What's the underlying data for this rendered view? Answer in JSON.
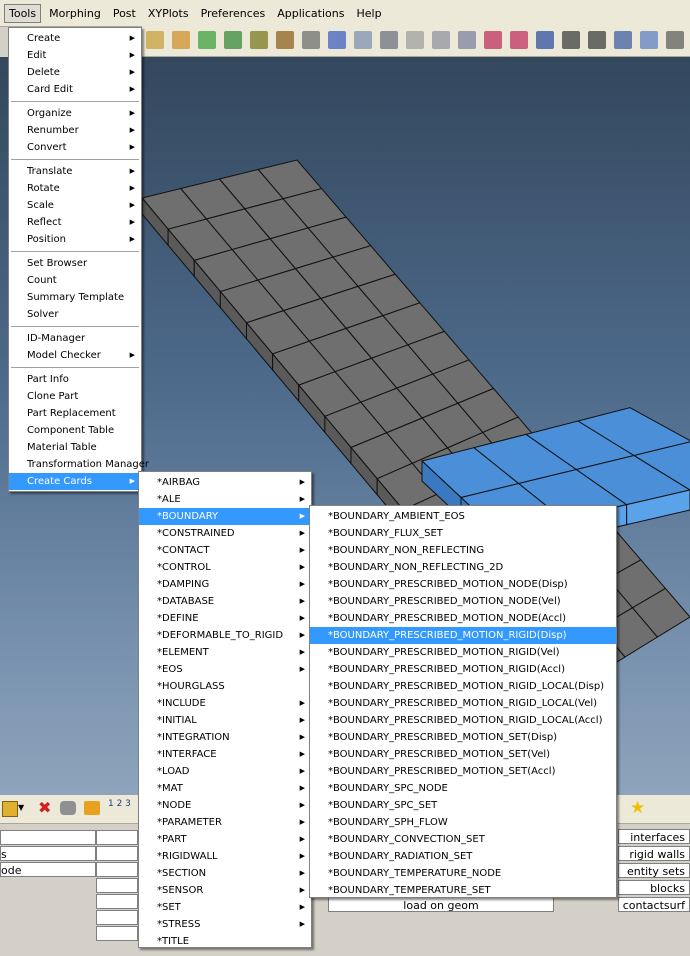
{
  "menubar": [
    "Tools",
    "Morphing",
    "Post",
    "XYPlots",
    "Preferences",
    "Applications",
    "Help"
  ],
  "tools_menu": [
    {
      "label": "Create",
      "arrow": true
    },
    {
      "label": "Edit",
      "arrow": true
    },
    {
      "label": "Delete",
      "arrow": true
    },
    {
      "label": "Card Edit",
      "arrow": true
    },
    {
      "sep": true
    },
    {
      "label": "Organize",
      "arrow": true
    },
    {
      "label": "Renumber",
      "arrow": true
    },
    {
      "label": "Convert",
      "arrow": true
    },
    {
      "sep": true
    },
    {
      "label": "Translate",
      "arrow": true
    },
    {
      "label": "Rotate",
      "arrow": true
    },
    {
      "label": "Scale",
      "arrow": true
    },
    {
      "label": "Reflect",
      "arrow": true
    },
    {
      "label": "Position",
      "arrow": true
    },
    {
      "sep": true
    },
    {
      "label": "Set Browser"
    },
    {
      "label": "Count"
    },
    {
      "label": "Summary Template"
    },
    {
      "label": "Solver"
    },
    {
      "sep": true
    },
    {
      "label": "ID-Manager"
    },
    {
      "label": "Model Checker",
      "arrow": true
    },
    {
      "sep": true
    },
    {
      "label": "Part Info"
    },
    {
      "label": "Clone Part"
    },
    {
      "label": "Part Replacement"
    },
    {
      "label": "Component Table"
    },
    {
      "label": "Material Table"
    },
    {
      "label": "Transformation Manager"
    },
    {
      "label": "Create Cards",
      "arrow": true,
      "hl": true
    }
  ],
  "cards_menu": [
    {
      "label": "*AIRBAG",
      "arrow": true
    },
    {
      "label": "*ALE",
      "arrow": true
    },
    {
      "label": "*BOUNDARY",
      "arrow": true,
      "hl": true
    },
    {
      "label": "*CONSTRAINED",
      "arrow": true
    },
    {
      "label": "*CONTACT",
      "arrow": true
    },
    {
      "label": "*CONTROL",
      "arrow": true
    },
    {
      "label": "*DAMPING",
      "arrow": true
    },
    {
      "label": "*DATABASE",
      "arrow": true
    },
    {
      "label": "*DEFINE",
      "arrow": true
    },
    {
      "label": "*DEFORMABLE_TO_RIGID",
      "arrow": true
    },
    {
      "label": "*ELEMENT",
      "arrow": true
    },
    {
      "label": "*EOS",
      "arrow": true
    },
    {
      "label": "*HOURGLASS"
    },
    {
      "label": "*INCLUDE",
      "arrow": true
    },
    {
      "label": "*INITIAL",
      "arrow": true
    },
    {
      "label": "*INTEGRATION",
      "arrow": true
    },
    {
      "label": "*INTERFACE",
      "arrow": true
    },
    {
      "label": "*LOAD",
      "arrow": true
    },
    {
      "label": "*MAT",
      "arrow": true
    },
    {
      "label": "*NODE",
      "arrow": true
    },
    {
      "label": "*PARAMETER",
      "arrow": true
    },
    {
      "label": "*PART",
      "arrow": true
    },
    {
      "label": "*RIGIDWALL",
      "arrow": true
    },
    {
      "label": "*SECTION",
      "arrow": true
    },
    {
      "label": "*SENSOR",
      "arrow": true
    },
    {
      "label": "*SET",
      "arrow": true
    },
    {
      "label": "*STRESS",
      "arrow": true
    },
    {
      "label": "*TITLE"
    }
  ],
  "boundary_menu": [
    "*BOUNDARY_AMBIENT_EOS",
    "*BOUNDARY_FLUX_SET",
    "*BOUNDARY_NON_REFLECTING",
    "*BOUNDARY_NON_REFLECTING_2D",
    "*BOUNDARY_PRESCRIBED_MOTION_NODE(Disp)",
    "*BOUNDARY_PRESCRIBED_MOTION_NODE(Vel)",
    "*BOUNDARY_PRESCRIBED_MOTION_NODE(Accl)",
    "*BOUNDARY_PRESCRIBED_MOTION_RIGID(Disp)",
    "*BOUNDARY_PRESCRIBED_MOTION_RIGID(Vel)",
    "*BOUNDARY_PRESCRIBED_MOTION_RIGID(Accl)",
    "*BOUNDARY_PRESCRIBED_MOTION_RIGID_LOCAL(Disp)",
    "*BOUNDARY_PRESCRIBED_MOTION_RIGID_LOCAL(Vel)",
    "*BOUNDARY_PRESCRIBED_MOTION_RIGID_LOCAL(Accl)",
    "*BOUNDARY_PRESCRIBED_MOTION_SET(Disp)",
    "*BOUNDARY_PRESCRIBED_MOTION_SET(Vel)",
    "*BOUNDARY_PRESCRIBED_MOTION_SET(Accl)",
    "*BOUNDARY_SPC_NODE",
    "*BOUNDARY_SPC_SET",
    "*BOUNDARY_SPH_FLOW",
    "*BOUNDARY_CONVECTION_SET",
    "*BOUNDARY_RADIATION_SET",
    "*BOUNDARY_TEMPERATURE_NODE",
    "*BOUNDARY_TEMPERATURE_SET"
  ],
  "boundary_highlight_index": 7,
  "panel": {
    "left_cells": [
      "s",
      "ode"
    ],
    "right_cells": [
      "interfaces",
      "rigid walls",
      "entity sets",
      "blocks",
      "contactsurf"
    ],
    "center_cell": "load on geom"
  },
  "colors": {
    "highlight": "#3399ff",
    "mesh_gray": "#6e6e6e",
    "mesh_blue": "#4a90d9"
  }
}
